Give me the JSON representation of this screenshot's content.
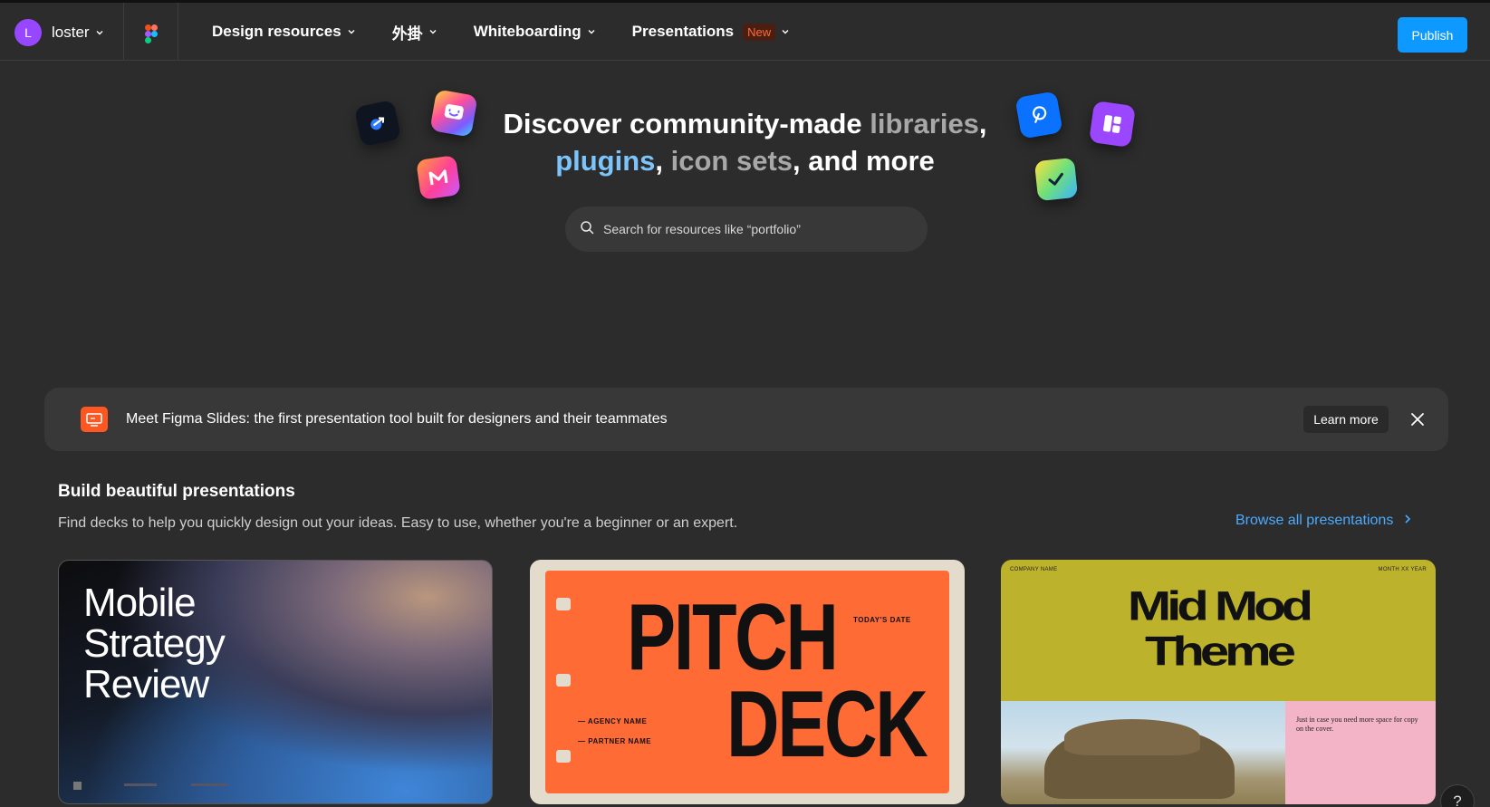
{
  "nav": {
    "avatar_letter": "L",
    "user_name": "loster",
    "items": [
      {
        "label": "Design resources"
      },
      {
        "label": "外掛"
      },
      {
        "label": "Whiteboarding"
      },
      {
        "label": "Presentations",
        "badge": "New"
      }
    ],
    "publish_label": "Publish"
  },
  "hero": {
    "title_part1": "Discover community-made ",
    "title_libraries": "libraries",
    "title_comma1": ",",
    "title_plugins": "plugins",
    "title_comma2": ", ",
    "title_iconsets": "icon sets",
    "title_rest": ", and more",
    "search_placeholder": "Search for resources like “portfolio”"
  },
  "banner": {
    "text": "Meet Figma Slides: the first presentation tool built for designers and their teammates",
    "learn_more": "Learn more"
  },
  "section": {
    "title": "Build beautiful presentations",
    "subtitle": "Find decks to help you quickly design out your ideas. Easy to use, whether you're a beginner or an expert.",
    "browse_link": "Browse all presentations"
  },
  "cards": [
    {
      "line1": "Mobile",
      "line2": "Strategy",
      "line3": "Review"
    },
    {
      "word1": "PITCH",
      "word2": "DECK",
      "date": "TODAY'S DATE",
      "agency": "— AGENCY NAME",
      "partner": "— PARTNER NAME"
    },
    {
      "company": "COMPANY NAME",
      "month": "MONTH XX YEAR",
      "line1": "Mid Mod",
      "line2": "Theme",
      "note": "Just in case you need more space for copy on the cover."
    }
  ],
  "help_label": "?",
  "colors": {
    "accent": "#0d99ff",
    "link": "#4aabff",
    "background": "#2c2c2c",
    "banner_icon": "#ff5722"
  }
}
